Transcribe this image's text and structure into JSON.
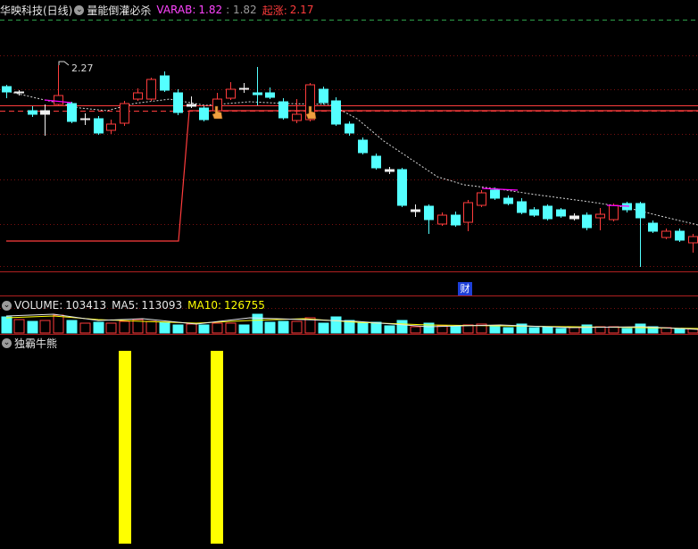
{
  "header": {
    "stock_title": "华映科技(日线)",
    "indicator_name": "量能倒灌必杀",
    "varab_label": "VARAB:",
    "varab_value": "1.82",
    "varab_value2": ": 1.82",
    "qizhang_label": "起涨:",
    "qizhang_value": "2.17"
  },
  "price_pane": {
    "high_label": "2.27",
    "event_badge": "财"
  },
  "volume_pane": {
    "volume_label": "VOLUME:",
    "volume_value": "103413",
    "ma5_label": "MA5:",
    "ma5_value": "113093",
    "ma10_label": "MA10:",
    "ma10_value": "126755"
  },
  "signal_pane": {
    "title": "独霸牛熊",
    "signal_count": 2
  },
  "colors": {
    "up": "#ff3c3c",
    "down": "#54ffff",
    "signal": "#ffff00",
    "magenta": "#ff00ff",
    "varab": "#ff44ff",
    "qizhang": "#ff3c3c",
    "volume_ma10": "#ffff00"
  },
  "icons": [
    "collapse-circle-icon",
    "pointing-hand-icon"
  ]
}
